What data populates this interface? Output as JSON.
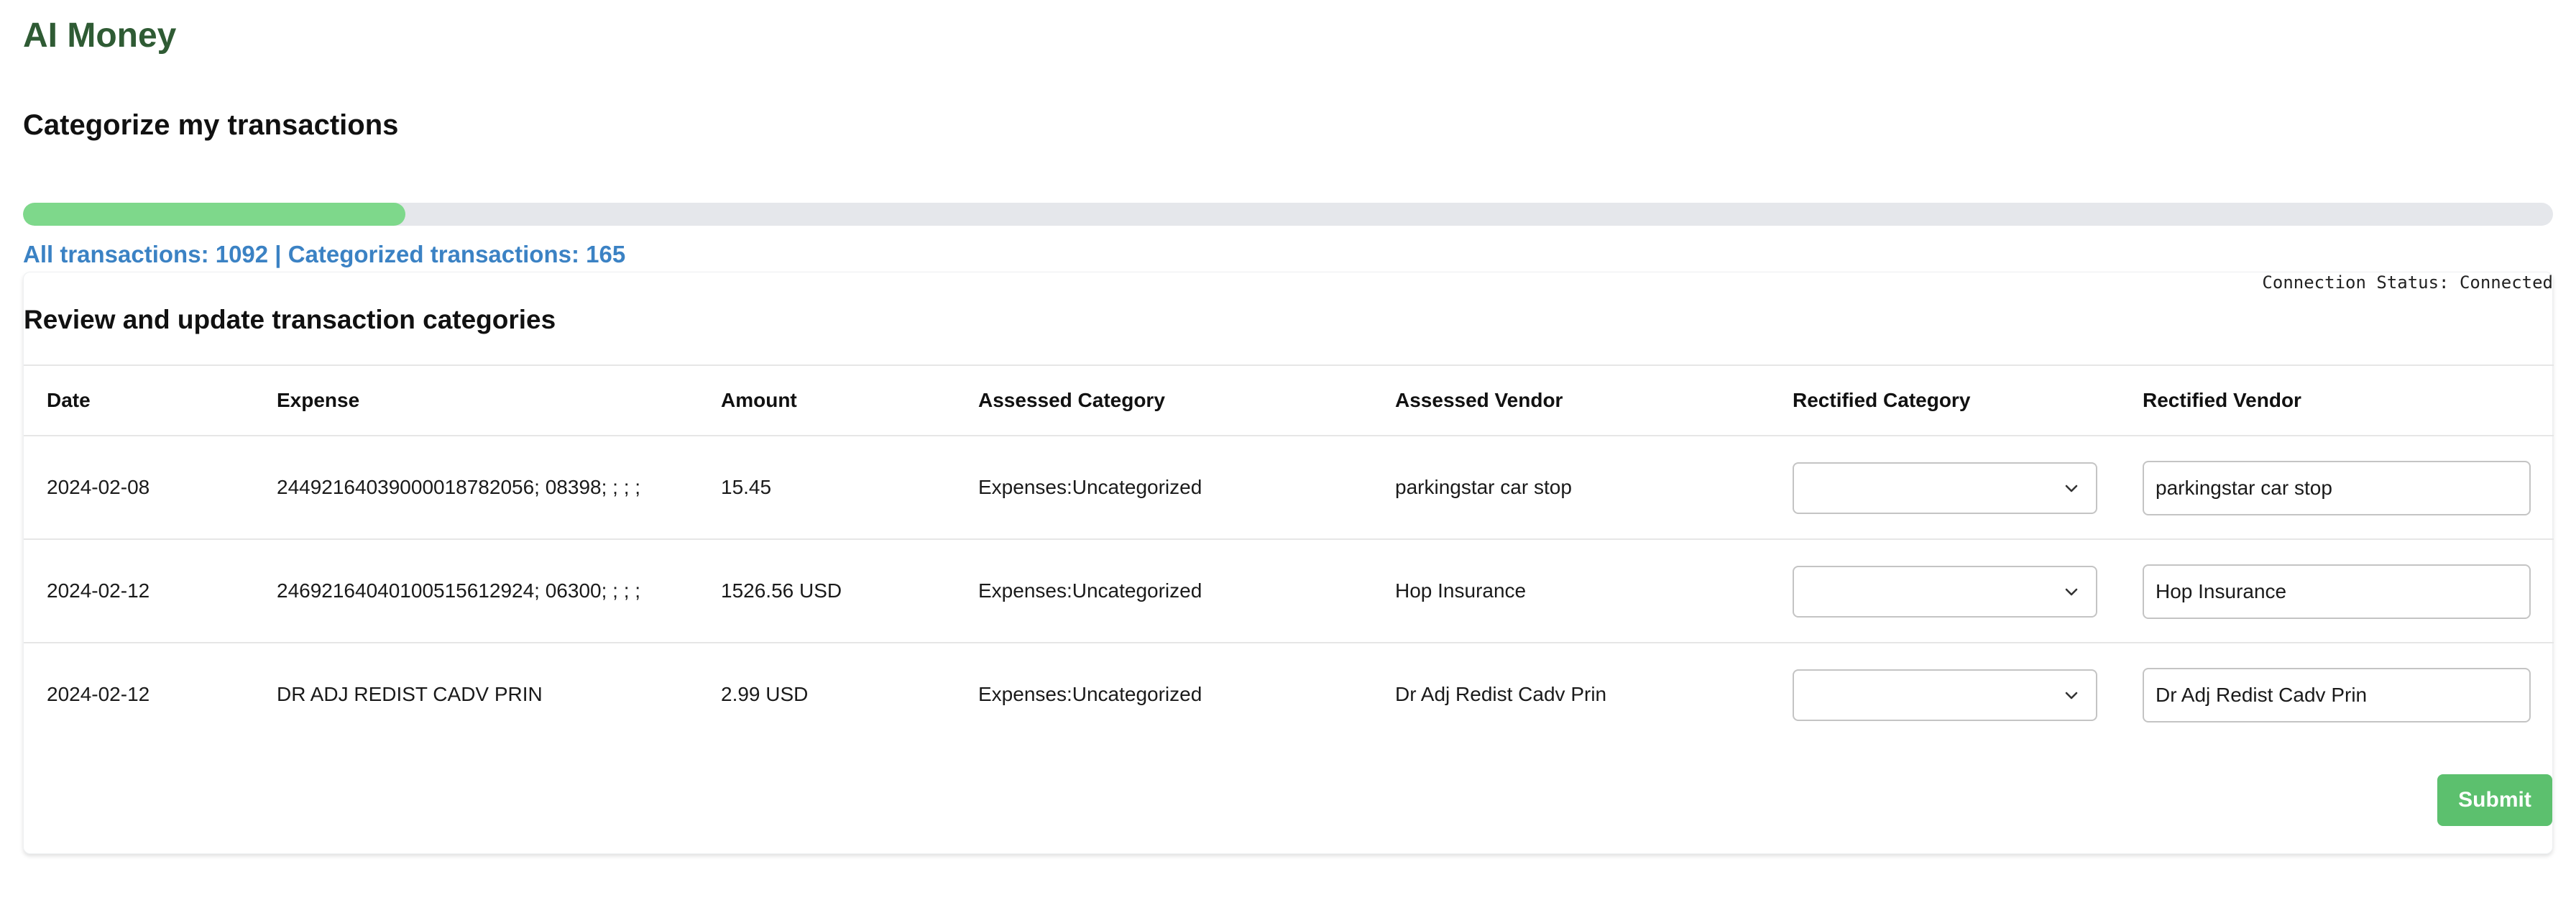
{
  "app": {
    "title": "AI Money"
  },
  "page": {
    "title": "Categorize my transactions"
  },
  "progress": {
    "fraction": 0.151,
    "summary": "All transactions: 1092 | Categorized transactions: 165"
  },
  "connection": {
    "status_text": "Connection Status: Connected"
  },
  "review": {
    "title": "Review and update transaction categories",
    "columns": [
      "Date",
      "Expense",
      "Amount",
      "Assessed Category",
      "Assessed Vendor",
      "Rectified Category",
      "Rectified Vendor"
    ],
    "rows": [
      {
        "date": "2024-02-08",
        "expense": "24492164039000018782056; 08398; ; ; ;",
        "amount": "15.45",
        "assessed_category": "Expenses:Uncategorized",
        "assessed_vendor": "parkingstar car stop",
        "rectified_category": "",
        "rectified_vendor": "parkingstar car stop"
      },
      {
        "date": "2024-02-12",
        "expense": "24692164040100515612924; 06300; ; ; ;",
        "amount": "1526.56 USD",
        "assessed_category": "Expenses:Uncategorized",
        "assessed_vendor": "Hop Insurance",
        "rectified_category": "",
        "rectified_vendor": "Hop Insurance"
      },
      {
        "date": "2024-02-12",
        "expense": "DR ADJ REDIST CADV PRIN",
        "amount": "2.99 USD",
        "assessed_category": "Expenses:Uncategorized",
        "assessed_vendor": "Dr Adj Redist Cadv Prin",
        "rectified_category": "",
        "rectified_vendor": "Dr Adj Redist Cadv Prin"
      }
    ],
    "submit_label": "Submit"
  },
  "icons": {
    "select_arrow": "chevron-down-icon"
  },
  "colors": {
    "brand": "#2f5b34",
    "progress_fill": "#7ed88b",
    "progress_track": "#e5e7eb",
    "summary_text": "#3b82c4",
    "submit_bg": "#5cc06e"
  }
}
